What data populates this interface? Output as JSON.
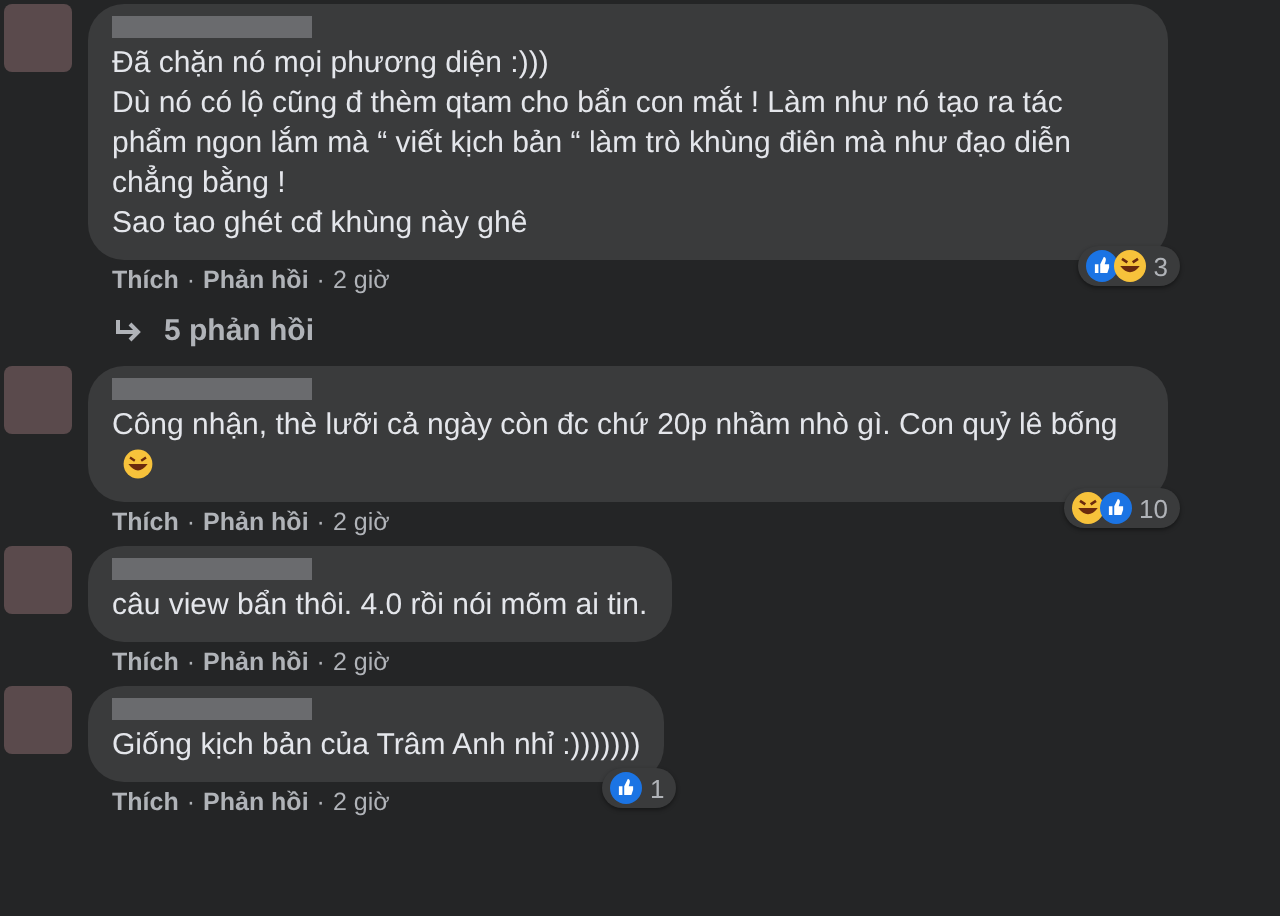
{
  "comments": [
    {
      "lines": [
        "Đã chặn nó mọi phương diện :)))",
        "Dù nó có lộ cũng đ thèm qtam cho bẩn con mắt ! Làm như nó tạo ra tác phẩm ngon lắm mà “ viết kịch bản “ làm trò khùng điên mà như đạo diễn chẳng bằng !",
        "Sao tao ghét cđ khùng này ghê"
      ],
      "reactions": [
        {
          "kind": "like"
        },
        {
          "kind": "haha"
        }
      ],
      "reaction_count": "3",
      "actions": [
        "Thích",
        "Phản hồi"
      ],
      "separator": "·",
      "time": "2 giờ",
      "replies": "5 phản hồi"
    },
    {
      "lines": [
        "Công nhận, thè lưỡi cả ngày còn đc chứ 20p nhầm nhò gì. Con quỷ lê bống"
      ],
      "trailing_emoji": {
        "kind": "haha"
      },
      "reactions": [
        {
          "kind": "haha"
        },
        {
          "kind": "like"
        }
      ],
      "reaction_count": "10",
      "actions": [
        "Thích",
        "Phản hồi"
      ],
      "separator": "·",
      "time": "2 giờ"
    },
    {
      "lines": [
        "câu view bẩn thôi. 4.0 rồi nói mõm ai tin."
      ],
      "actions": [
        "Thích",
        "Phản hồi"
      ],
      "separator": "·",
      "time": "2 giờ"
    },
    {
      "lines": [
        "Giống kịch bản của Trâm Anh nhỉ :)))))))"
      ],
      "reactions": [
        {
          "kind": "like"
        }
      ],
      "reaction_count": "1",
      "actions": [
        "Thích",
        "Phản hồi"
      ],
      "separator": "·",
      "time": "2 giờ"
    }
  ]
}
